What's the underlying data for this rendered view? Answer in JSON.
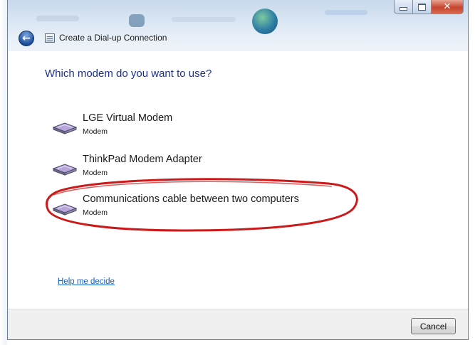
{
  "window": {
    "title": "Create a Dial-up Connection",
    "controls": {
      "minimize": "minimize",
      "maximize": "maximize",
      "close": "close"
    }
  },
  "prompt": "Which modem do you want to use?",
  "modems": [
    {
      "name": "LGE Virtual Modem",
      "type": "Modem",
      "highlighted": false
    },
    {
      "name": "ThinkPad Modem Adapter",
      "type": "Modem",
      "highlighted": false
    },
    {
      "name": "Communications cable between two computers",
      "type": "Modem",
      "highlighted": true
    }
  ],
  "help_link": "Help me decide",
  "footer": {
    "cancel_label": "Cancel"
  },
  "icons": {
    "back": "back-arrow-icon",
    "app": "dialup-connection-icon",
    "modem": "modem-icon"
  },
  "colors": {
    "heading": "#1e3287",
    "link": "#1561c4",
    "highlight_annotation": "#cc1a1a",
    "close_button": "#c6452e"
  }
}
